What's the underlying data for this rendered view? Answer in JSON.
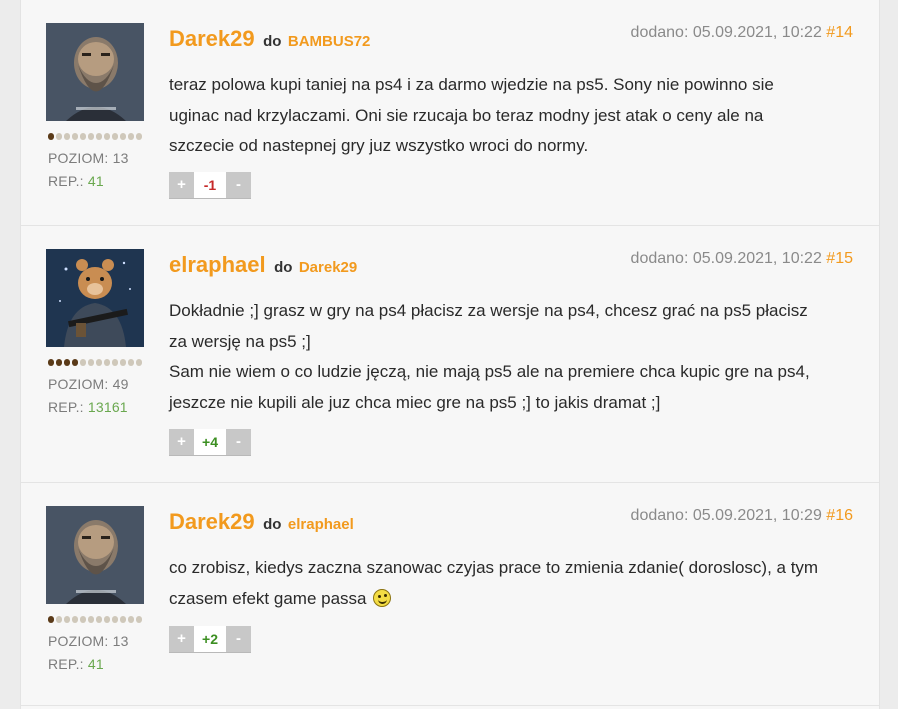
{
  "posts": [
    {
      "author": "Darek29",
      "to_word": "do",
      "reply_to": "BAMBUS72",
      "date_text": "dodano: 05.09.2021, 10:22",
      "number": "#14",
      "lines": [
        "teraz polowa kupi taniej na ps4 i za darmo wjedzie na ps5. Sony nie powinno sie",
        "uginac nad krzylaczami. Oni sie rzucaja bo teraz modny jest atak o ceny ale na",
        "szczecie od nastepnej gry juz wszystko wroci do normy."
      ],
      "level_label": "POZIOM: 13",
      "rep_label": "REP.:",
      "rep_value": "41",
      "level_dots_filled": 1,
      "level_dots_total": 12,
      "vote_plus": "+",
      "vote_score": "-1",
      "vote_minus": "-",
      "avatar_icon": "bearded-warrior-avatar"
    },
    {
      "author": "elraphael",
      "to_word": "do",
      "reply_to": "Darek29",
      "date_text": "dodano: 05.09.2021, 10:22",
      "number": "#15",
      "lines": [
        "Dokładnie ;] grasz w gry na ps4 płacisz za wersje na ps4, chcesz grać na ps5 płacisz",
        "za wersję na ps5 ;]",
        "Sam nie wiem o co ludzie jęczą, nie mają ps5 ale na premiere chca kupic gre na ps4,",
        "jeszcze nie kupili ale juz chca miec gre na ps5 ;] to jakis dramat ;]"
      ],
      "level_label": "POZIOM: 49",
      "rep_label": "REP.:",
      "rep_value": "13161",
      "level_dots_filled": 4,
      "level_dots_total": 12,
      "vote_plus": "+",
      "vote_score": "+4",
      "vote_minus": "-",
      "avatar_icon": "armed-bear-avatar"
    },
    {
      "author": "Darek29",
      "to_word": "do",
      "reply_to": "elraphael",
      "date_text": "dodano: 05.09.2021, 10:29",
      "number": "#16",
      "lines": [
        "co zrobisz, kiedys zaczna szanowac czyjas prace to zmienia zdanie( doroslosc), a tym",
        "czasem efekt game passa"
      ],
      "level_label": "POZIOM: 13",
      "rep_label": "REP.:",
      "rep_value": "41",
      "level_dots_filled": 1,
      "level_dots_total": 12,
      "vote_plus": "+",
      "vote_score": "+2",
      "vote_minus": "-",
      "avatar_icon": "bearded-warrior-avatar",
      "trailing_icon": "wink-smiley-icon"
    }
  ],
  "colors": {
    "accent": "#f29a1e",
    "rep_green": "#6aa84f",
    "negative": "#c62828",
    "positive": "#3c8f22"
  }
}
